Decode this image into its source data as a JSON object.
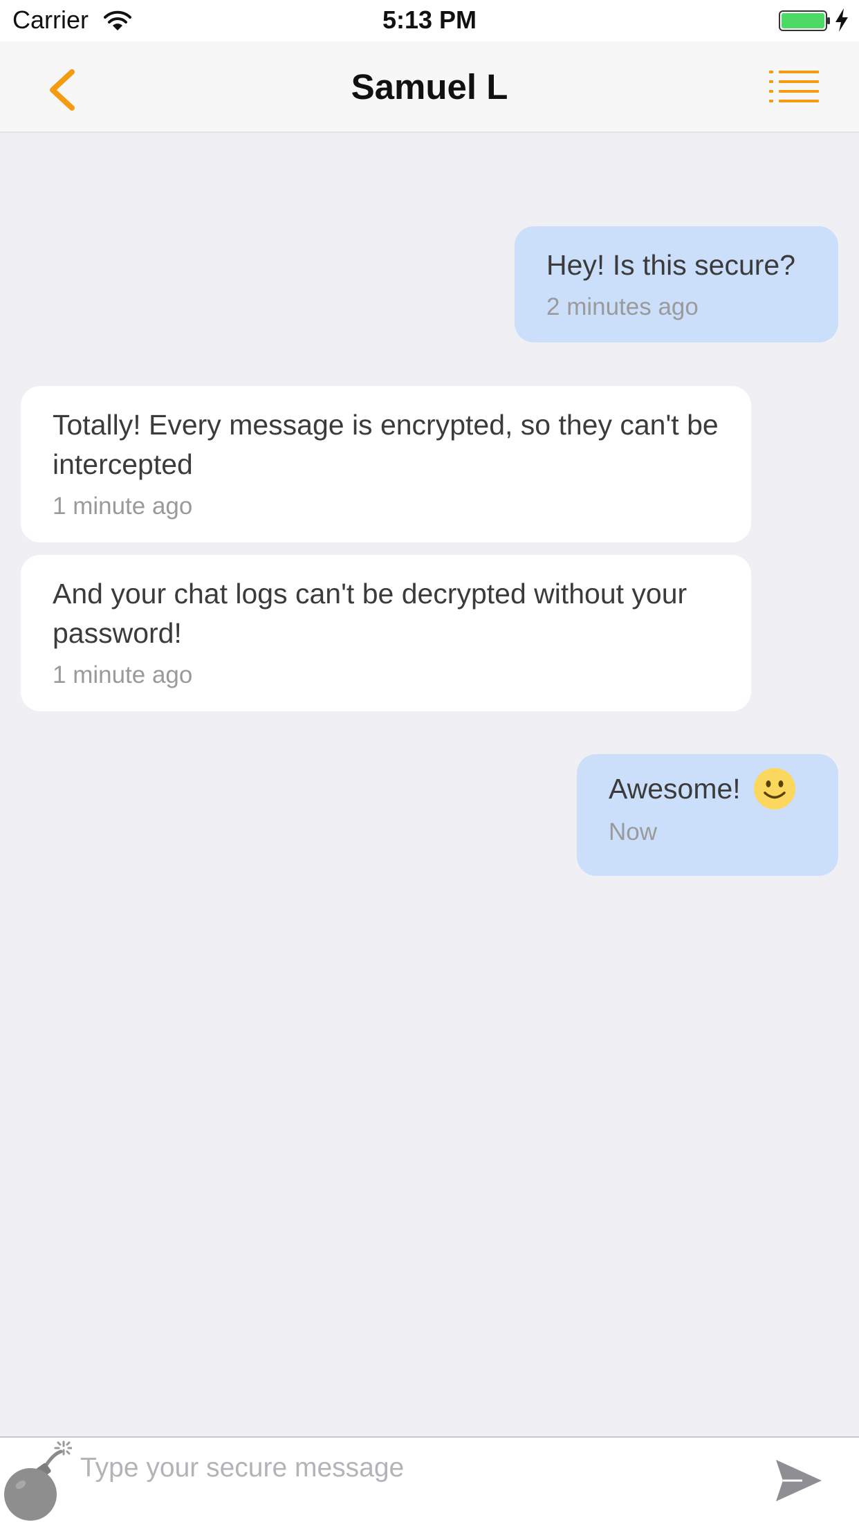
{
  "status_bar": {
    "carrier": "Carrier",
    "time": "5:13 PM",
    "wifi_icon": "wifi-icon",
    "battery_icon": "battery-icon",
    "battery_color": "#4cd964"
  },
  "nav": {
    "title": "Samuel L",
    "back_icon": "chevron-left-icon",
    "menu_icon": "list-icon",
    "accent_color": "#f39c12"
  },
  "messages": [
    {
      "direction": "outgoing",
      "text": "Hey! Is this secure?",
      "time": "2 minutes ago"
    },
    {
      "direction": "incoming",
      "text": "Totally! Every message is encrypted, so they can't be intercepted",
      "time": "1 minute ago"
    },
    {
      "direction": "incoming",
      "text": "And your chat logs can't be decrypted without your password!",
      "time": "1 minute ago"
    },
    {
      "direction": "outgoing",
      "text": "Awesome!",
      "emoji": "smiley-icon",
      "time": "Now"
    }
  ],
  "colors": {
    "outgoing_bubble": "#cbdffa",
    "incoming_bubble": "#ffffff",
    "background": "#efeff4"
  },
  "input": {
    "placeholder": "Type your secure message",
    "value": "",
    "bomb_icon": "bomb-icon",
    "send_icon": "send-icon"
  }
}
